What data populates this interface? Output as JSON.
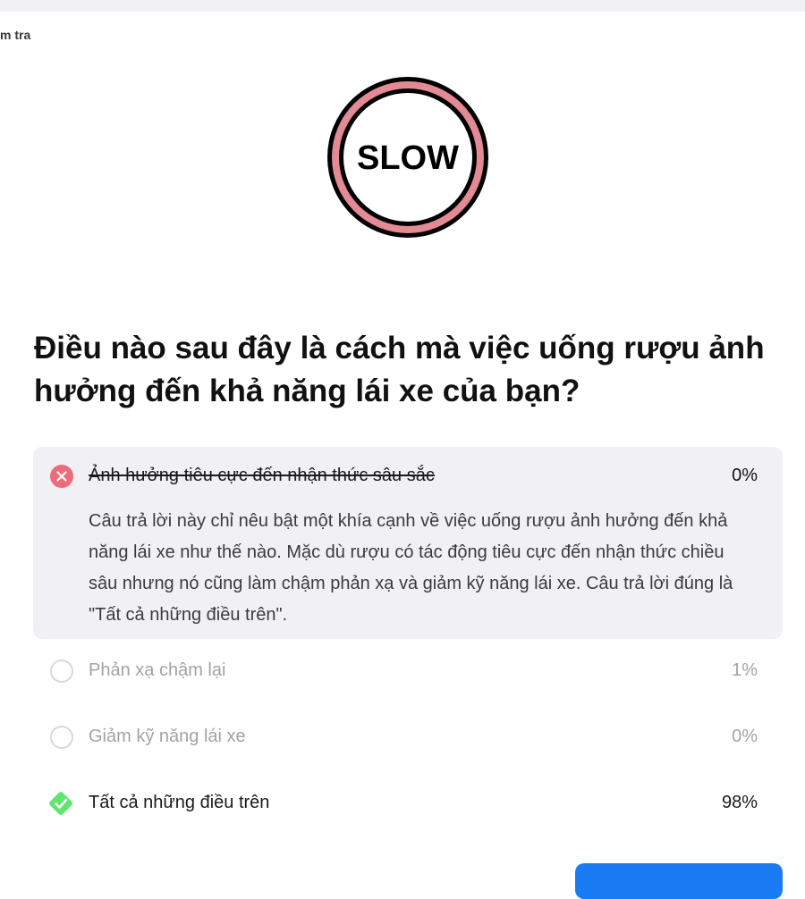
{
  "header": {
    "breadcrumb": "m tra"
  },
  "sign": {
    "text": "SLOW",
    "ring_color": "#e38a94"
  },
  "question": {
    "text": "Điều nào sau đây là cách mà việc uống rượu ảnh hưởng đến khả năng lái xe của bạn?"
  },
  "options": [
    {
      "label": "Ảnh hưởng tiêu cực đến nhận thức sâu sắc",
      "percent": "0%",
      "state": "incorrect-selected",
      "icon": "x-circle-icon",
      "icon_color": "#ef6b78",
      "explanation": "Câu trả lời này chỉ nêu bật một khía cạnh về việc uống rượu ảnh hưởng đến khả năng lái xe như thế nào. Mặc dù rượu có tác động tiêu cực đến nhận thức chiều sâu nhưng nó cũng làm chậm phản xạ và giảm kỹ năng lái xe. Câu trả lời đúng là \"Tất cả những điều trên\"."
    },
    {
      "label": "Phản xạ chậm lại",
      "percent": "1%",
      "state": "unselected",
      "icon": "empty-circle-icon"
    },
    {
      "label": "Giảm kỹ năng lái xe",
      "percent": "0%",
      "state": "unselected",
      "icon": "empty-circle-icon"
    },
    {
      "label": "Tất cả những điều trên",
      "percent": "98%",
      "state": "correct",
      "icon": "check-diamond-icon",
      "icon_color": "#5ee66e"
    }
  ],
  "colors": {
    "accent_blue": "#1a7cf5",
    "selected_bg": "#f1f1f5",
    "muted_text": "#a3a3a3"
  }
}
